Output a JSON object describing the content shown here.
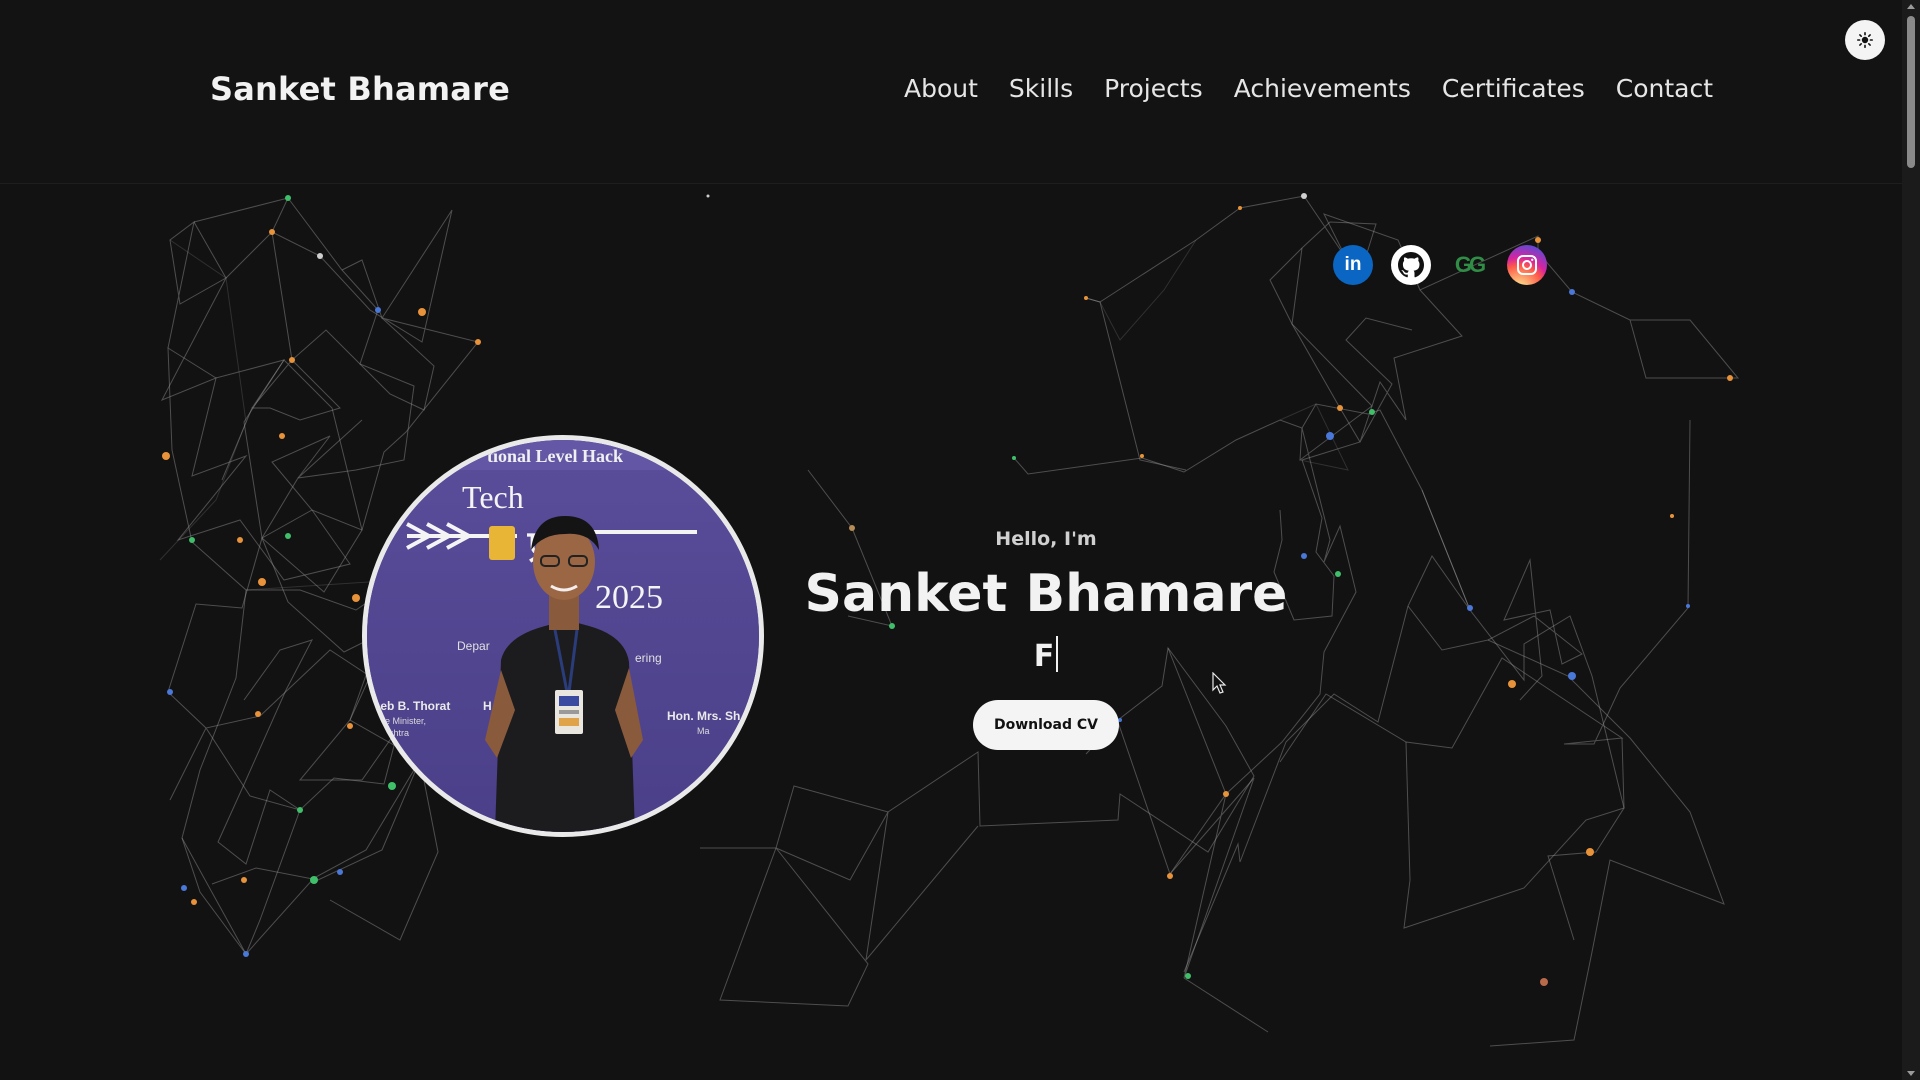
{
  "header": {
    "brand": "Sanket Bhamare",
    "nav": [
      {
        "label": "About"
      },
      {
        "label": "Skills"
      },
      {
        "label": "Projects"
      },
      {
        "label": "Achievements"
      },
      {
        "label": "Certificates"
      },
      {
        "label": "Contact"
      }
    ],
    "theme_toggle_icon": "sun-icon"
  },
  "socials": [
    {
      "name": "LinkedIn",
      "icon": "linkedin-icon",
      "text": "in",
      "color": "#0a66c2"
    },
    {
      "name": "GitHub",
      "icon": "github-icon",
      "color": "#ffffff"
    },
    {
      "name": "GeeksforGeeks",
      "icon": "gfg-icon",
      "text": "GG",
      "color": "#2f8d46"
    },
    {
      "name": "Instagram",
      "icon": "instagram-icon",
      "color": "#d6249f"
    }
  ],
  "hero": {
    "greeting": "Hello, I'm",
    "name": "Sanket Bhamare",
    "typed_text": "F",
    "cta_label": "Download CV"
  },
  "photo": {
    "banner_line1": "tional Level Hack",
    "banner_tech": "Tech",
    "banner_year": "2025",
    "banner_dept": "Depar",
    "banner_eering": "ering",
    "caption_left": "heb B. Thorat",
    "caption_left_sub": "e Minister,",
    "caption_left_sub2": "shtra",
    "caption_right": "Hon. Mrs. Sh",
    "caption_right_sub": "Ma"
  },
  "colors": {
    "background": "#121212",
    "accent": "#f4f4f4",
    "node_orange": "#e8923a",
    "node_blue": "#4a78d8",
    "node_green": "#3fbf6a"
  }
}
